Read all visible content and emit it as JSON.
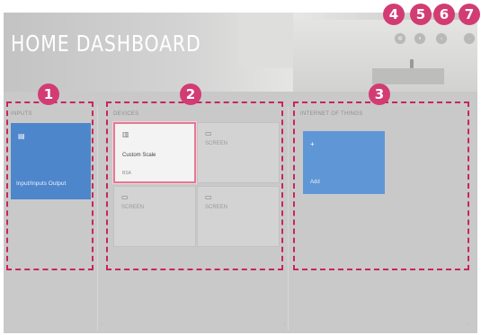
{
  "header": {
    "title": "HOME DASHBOARD"
  },
  "top_buttons": [
    {
      "name": "settings-button",
      "icon": "gear-icon",
      "glyph": "✲"
    },
    {
      "name": "help-button",
      "icon": "help-icon",
      "glyph": "•"
    },
    {
      "name": "refresh-button",
      "icon": "refresh-icon",
      "glyph": "◦"
    },
    {
      "name": "close-button",
      "icon": "close-icon",
      "glyph": "·"
    }
  ],
  "sections": {
    "inputs": {
      "header": "INPUTS",
      "card": {
        "icon": "hdmi-icon",
        "glyph": "▤",
        "label": "Input/Inputs Output"
      }
    },
    "devices": {
      "header": "DEVICES",
      "tiles": [
        {
          "icon": "speaker-icon",
          "glyph": "▥",
          "label": "Custom Scale",
          "sub": "BSA",
          "selected": true
        },
        {
          "icon": "device-icon",
          "glyph": "▭",
          "label": "SCREEN",
          "sub": "",
          "selected": false
        },
        {
          "icon": "device-icon",
          "glyph": "▭",
          "label": "SCREEN",
          "sub": "",
          "selected": false
        },
        {
          "icon": "device-icon",
          "glyph": "▭",
          "label": "SCREEN",
          "sub": "",
          "selected": false
        }
      ]
    },
    "iot": {
      "header": "INTERNET OF THINGS",
      "card": {
        "icon": "plus-icon",
        "glyph": "+",
        "label": "Add"
      }
    }
  },
  "callouts": [
    "1",
    "2",
    "3",
    "4",
    "5",
    "6",
    "7"
  ],
  "colors": {
    "callout": "#c8265a",
    "badge": "#d23c73",
    "input_card": "#4e86cc",
    "iot_card": "#5f96d6",
    "selection_border": "#e17a95"
  }
}
